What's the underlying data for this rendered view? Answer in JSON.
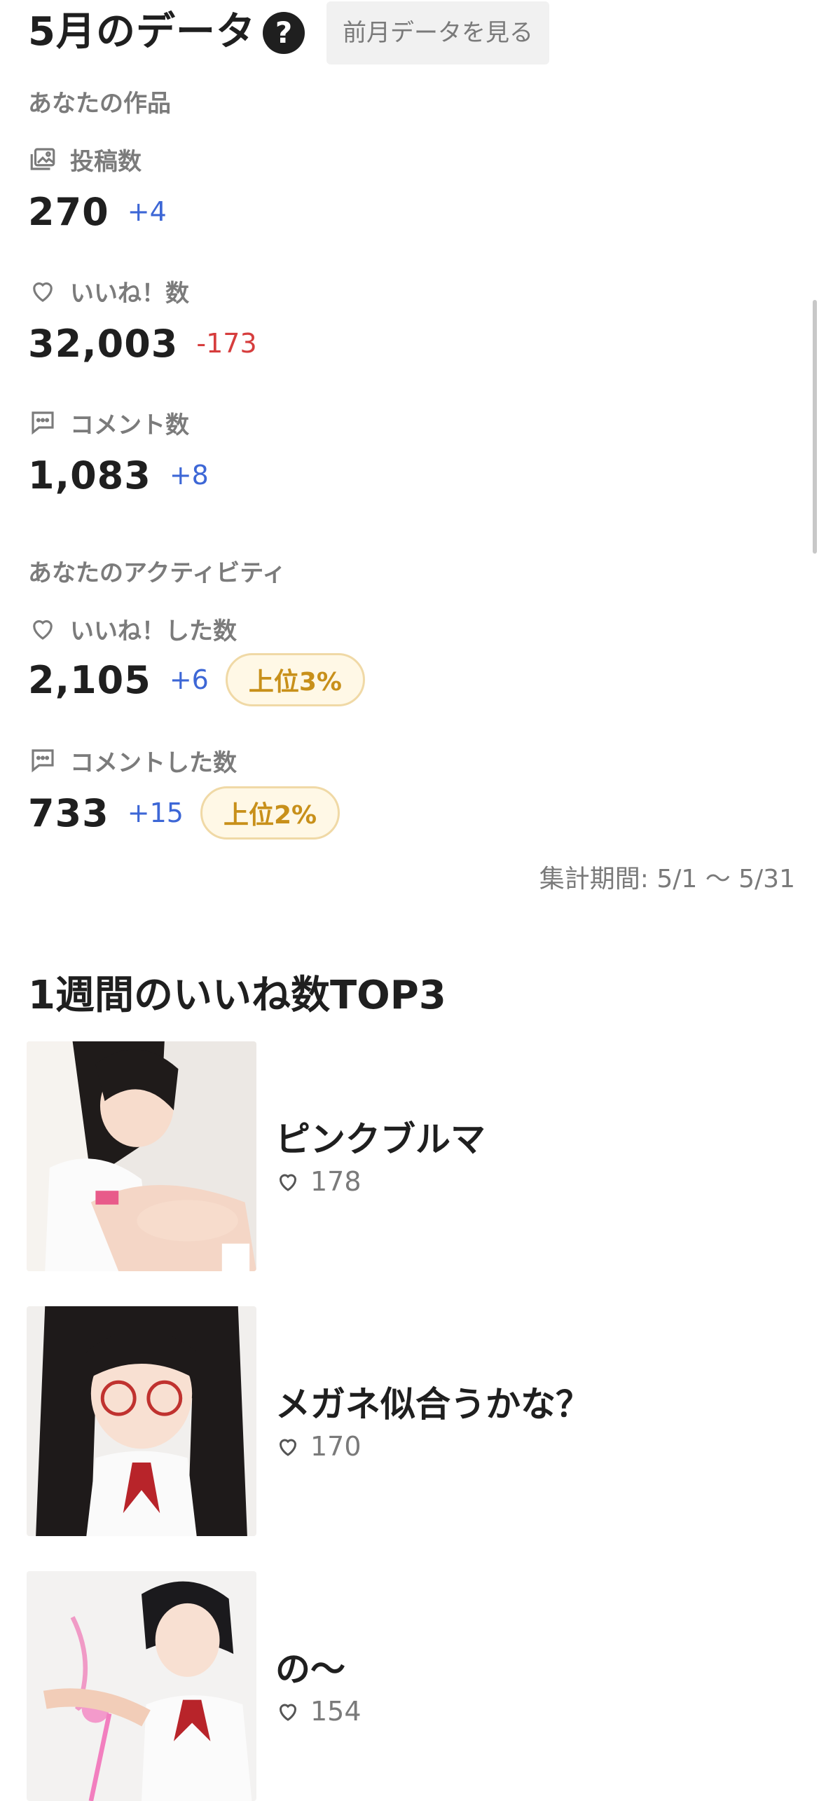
{
  "header": {
    "title": "5月のデータ",
    "help_label": "?",
    "prev_button_label": "前月データを見る"
  },
  "your_works": {
    "section_title": "あなたの作品",
    "metrics": [
      {
        "icon": "images-icon",
        "label": "投稿数",
        "value": "270",
        "delta": "+4",
        "trend": "up"
      },
      {
        "icon": "heart-icon",
        "label": "いいね！数",
        "value": "32,003",
        "delta": "-173",
        "trend": "down"
      },
      {
        "icon": "comment-icon",
        "label": "コメント数",
        "value": "1,083",
        "delta": "+8",
        "trend": "up"
      }
    ]
  },
  "your_activity": {
    "section_title": "あなたのアクティビティ",
    "metrics": [
      {
        "icon": "heart-icon",
        "label": "いいね！した数",
        "value": "2,105",
        "delta": "+6",
        "trend": "up",
        "rank_badge": "上位3%"
      },
      {
        "icon": "comment-icon",
        "label": "コメントした数",
        "value": "733",
        "delta": "+15",
        "trend": "up",
        "rank_badge": "上位2%"
      }
    ]
  },
  "period_text": "集計期間: 5/1 〜 5/31",
  "top3": {
    "title": "1週間のいいね数TOP3",
    "items": [
      {
        "title": "ピンクブルマ",
        "likes": "178"
      },
      {
        "title": "メガネ似合うかな？",
        "likes": "170"
      },
      {
        "title": "の〜",
        "likes": "154"
      }
    ]
  },
  "colors": {
    "positive": "#3d67d6",
    "negative": "#d63d3d",
    "badge_text": "#c8901a",
    "badge_bg": "#fff8e6",
    "badge_border": "#f0d9a6"
  }
}
